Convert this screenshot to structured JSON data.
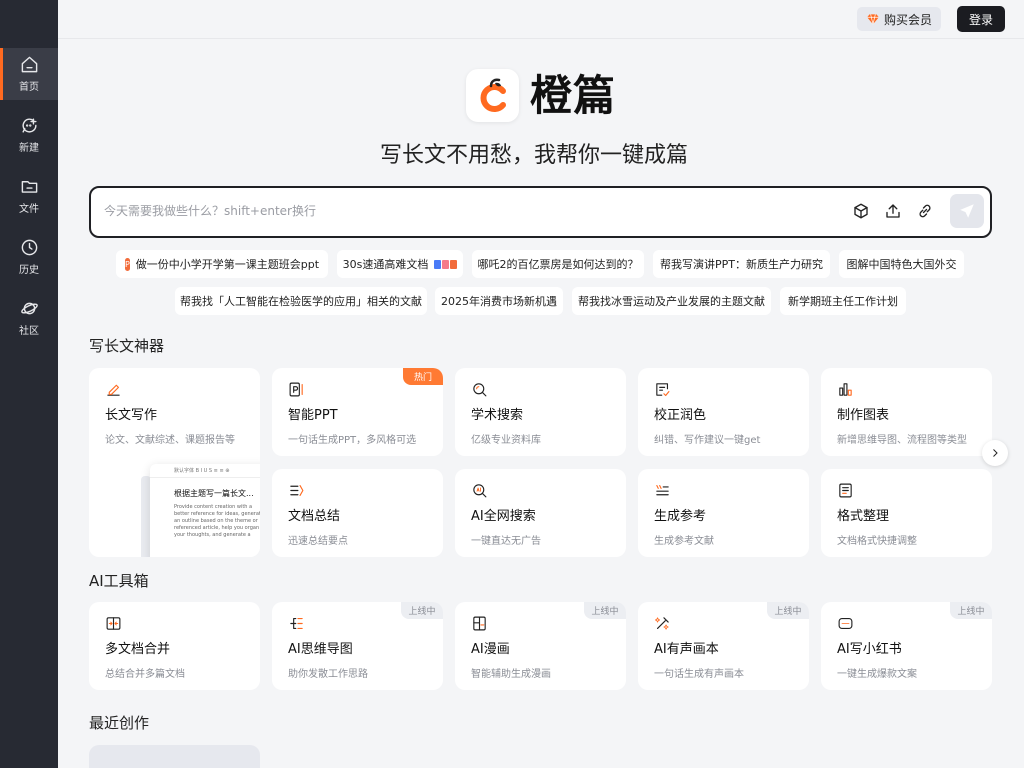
{
  "sidebar": {
    "items": [
      {
        "label": "首页",
        "icon": "home-icon",
        "active": true
      },
      {
        "label": "新建",
        "icon": "new-chat-icon"
      },
      {
        "label": "文件",
        "icon": "folder-icon"
      },
      {
        "label": "历史",
        "icon": "clock-icon"
      },
      {
        "label": "社区",
        "icon": "planet-icon"
      }
    ]
  },
  "topbar": {
    "vip_label": "购买会员",
    "login_label": "登录"
  },
  "hero": {
    "brand": "橙篇",
    "tagline": "写长文不用愁，我帮你一键成篇"
  },
  "search": {
    "placeholder": "今天需要我做些什么？shift+enter换行"
  },
  "suggestions": [
    "做一份中小学开学第一课主题班会ppt",
    "30s速通高难文档",
    "哪吒2的百亿票房是如何达到的？",
    "帮我写演讲PPT：新质生产力研究",
    "图解中国特色大国外交",
    "帮我找「人工智能在检验医学的应用」相关的文献",
    "2025年消费市场新机遇",
    "帮我找冰雪运动及产业发展的主题文献",
    "新学期班主任工作计划"
  ],
  "writing_section": {
    "title": "写长文神器",
    "hot_tag": "热门",
    "cards": [
      {
        "title": "长文写作",
        "desc": "论文、文献综述、课题报告等",
        "icon": "pen-icon"
      },
      {
        "title": "智能PPT",
        "desc": "一句话生成PPT，多风格可选",
        "icon": "ppt-icon"
      },
      {
        "title": "学术搜索",
        "desc": "亿级专业资料库",
        "icon": "search-icon"
      },
      {
        "title": "校正润色",
        "desc": "纠错、写作建议一键get",
        "icon": "proofread-icon"
      },
      {
        "title": "制作图表",
        "desc": "新增思维导图、流程图等类型",
        "icon": "chart-icon"
      },
      {
        "title": "文档总结",
        "desc": "迅速总结要点",
        "icon": "summary-icon"
      },
      {
        "title": "AI全网搜索",
        "desc": "一键直达无广告",
        "icon": "ai-search-icon"
      },
      {
        "title": "生成参考",
        "desc": "生成参考文献",
        "icon": "quote-icon"
      },
      {
        "title": "格式整理",
        "desc": "文档格式快捷调整",
        "icon": "format-icon"
      }
    ],
    "preview": {
      "toolbar": "默认字体  B  I  U  S  ≡  ≡  ⊕",
      "heading": "根据主题写一篇长文...",
      "body": "Provide content creation with a better reference for ideas, generate an outline based on the theme or referenced article, help you organ your thoughts, and generate a"
    }
  },
  "toolbox_section": {
    "title": "AI工具箱",
    "soon_tag": "上线中",
    "cards": [
      {
        "title": "多文档合并",
        "desc": "总结合并多篇文档",
        "icon": "merge-icon"
      },
      {
        "title": "AI思维导图",
        "desc": "助你发散工作思路",
        "icon": "mindmap-icon"
      },
      {
        "title": "AI漫画",
        "desc": "智能辅助生成漫画",
        "icon": "comic-icon"
      },
      {
        "title": "AI有声画本",
        "desc": "一句话生成有声画本",
        "icon": "audio-book-icon"
      },
      {
        "title": "AI写小红书",
        "desc": "一键生成爆款文案",
        "icon": "xiaohongshu-icon"
      }
    ]
  },
  "recent_section": {
    "title": "最近创作"
  },
  "colors": {
    "accent": "#ff6a20",
    "sidebar_bg": "#272a33",
    "page_bg": "#f4f5f7"
  }
}
